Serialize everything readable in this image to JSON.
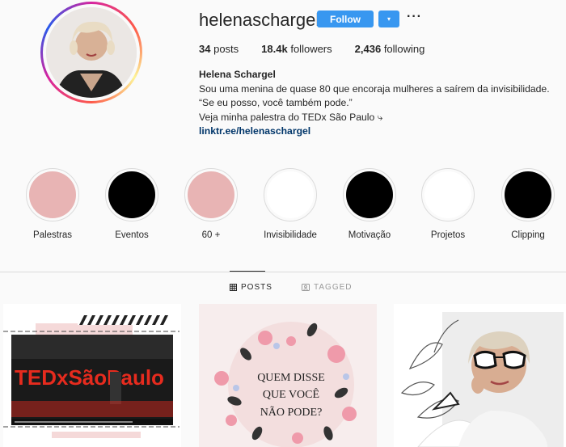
{
  "profile": {
    "username": "helenaschargel",
    "follow_label": "Follow",
    "dropdown_symbol": "▾",
    "more_symbol": "···"
  },
  "stats": {
    "posts_count": "34",
    "posts_label": "posts",
    "followers_count": "18.4k",
    "followers_label": "followers",
    "following_count": "2,436",
    "following_label": "following"
  },
  "bio": {
    "name": "Helena Schargel",
    "line1": "Sou uma menina de quase 80 que encoraja mulheres a saírem da invisibilidade.",
    "line2": "“Se eu posso, você também pode.”",
    "line3": "Veja minha palestra do TEDx São Paulo ⤷",
    "link": "linktr.ee/helenaschargel"
  },
  "highlights": [
    {
      "label": "Palestras",
      "color": "#e8b4b4"
    },
    {
      "label": "Eventos",
      "color": "#000000"
    },
    {
      "label": "60 +",
      "color": "#e8b4b4"
    },
    {
      "label": "Invisibilidade",
      "color": "#ffffff"
    },
    {
      "label": "Motivação",
      "color": "#000000"
    },
    {
      "label": "Projetos",
      "color": "#ffffff"
    },
    {
      "label": "Clipping",
      "color": "#000000"
    }
  ],
  "tabs": {
    "posts": "POSTS",
    "tagged": "TAGGED"
  },
  "posts": {
    "post1_text": "TEDxSãoPaulo",
    "post2_line1": "QUEM DISSE",
    "post2_line2": "QUE VOCÊ",
    "post2_line3": "NÃO PODE?"
  },
  "colors": {
    "accent": "#3897f0",
    "link": "#003569",
    "ted_red": "#e62b1e"
  }
}
